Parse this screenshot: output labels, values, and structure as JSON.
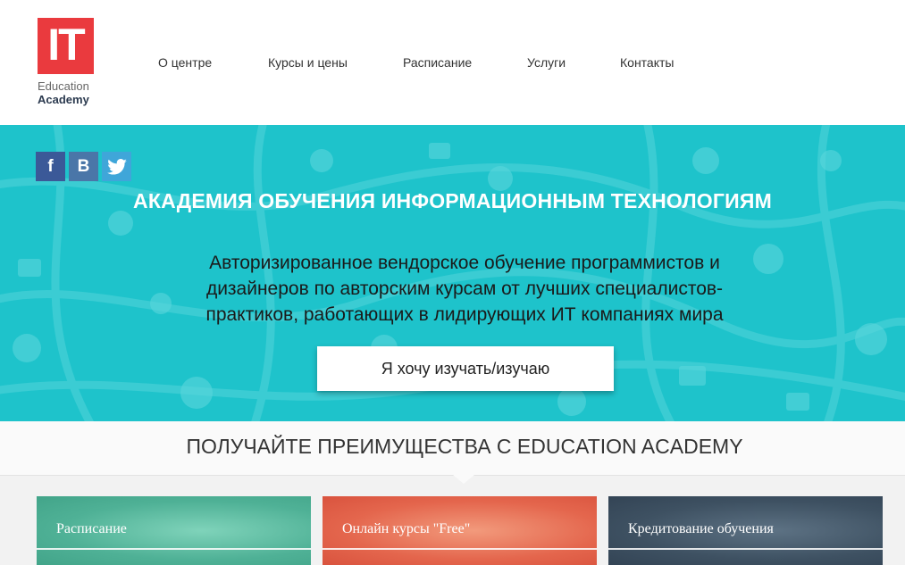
{
  "logo": {
    "mark": "IT",
    "line1": "Education",
    "line2": "Academy"
  },
  "nav": {
    "items": [
      {
        "label": "О центре"
      },
      {
        "label": "Курсы и цены"
      },
      {
        "label": "Расписание"
      },
      {
        "label": "Услуги"
      },
      {
        "label": "Контакты"
      }
    ]
  },
  "social": {
    "facebook": "f",
    "vk": "B",
    "twitter_icon": "twitter-bird-icon"
  },
  "colors": {
    "brand_red": "#ea3a3e",
    "hero_teal": "#1ec3cb",
    "card_green": "#4fb196",
    "card_red": "#e4664d",
    "card_dark": "#3e5162"
  },
  "hero": {
    "title": "АКАДЕМИЯ ОБУЧЕНИЯ ИНФОРМАЦИОННЫМ ТЕХНОЛОГИЯМ",
    "subtitle": "Авторизированное вендорское обучение программистов и дизайнеров по авторским курсам от лучших специалистов-практиков, работающих в лидирующих ИТ компаниях мира",
    "button": "Я хочу изучать/изучаю"
  },
  "benefits": {
    "title": "ПОЛУЧАЙТЕ ПРЕИМУЩЕСТВА С EDUCATION ACADEMY"
  },
  "cards": [
    {
      "label": "Расписание"
    },
    {
      "label": "Онлайн курсы \"Free\""
    },
    {
      "label": "Кредитование обучения"
    }
  ]
}
